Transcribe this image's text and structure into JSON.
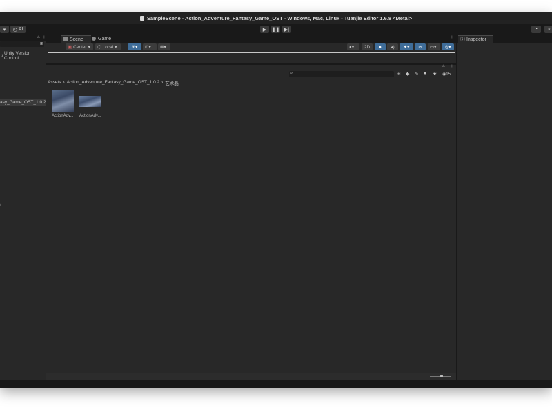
{
  "window": {
    "title": "SampleScene - Action_Adventure_Fantasy_Game_OST - Windows, Mac, Linux - Tuanjie Editor 1.6.8 <Metal>"
  },
  "toolbar": {
    "ai_label": "AI"
  },
  "hierarchy": {
    "version_control_label": "Unity Version Control",
    "selected_item": "asy_Game_OST_1.0.2"
  },
  "scene_tabs": [
    {
      "label": "Scene",
      "active": true
    },
    {
      "label": "Game",
      "active": false
    }
  ],
  "scene_toolbar": {
    "pivot_label": "Center",
    "space_label": "Local",
    "mode_2d_label": "2D"
  },
  "project": {
    "breadcrumb": [
      "Assets",
      "Action_Adventure_Fantasy_Game_OST_1.0.2",
      "艺术品"
    ],
    "visible_count": "15",
    "assets": [
      {
        "name": "ActionAdv..."
      },
      {
        "name": "ActionAdv..."
      }
    ]
  },
  "inspector": {
    "tab_label": "Inspector"
  },
  "colors": {
    "accent": "#3f6d99",
    "panel": "#282828",
    "chrome": "#191919"
  }
}
